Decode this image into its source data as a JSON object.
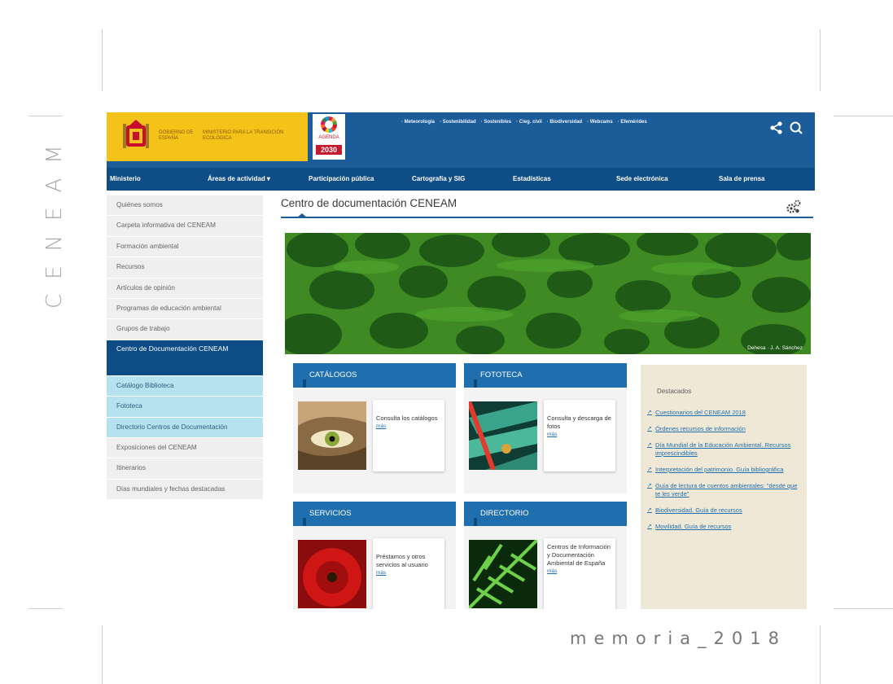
{
  "doc": {
    "side_title": "CENEAM",
    "footer": "memoria_2018"
  },
  "header": {
    "gov_label_1": "GOBIERNO DE ESPAÑA",
    "gov_label_2": "MINISTERIO PARA LA TRANSICIÓN ECOLÓGICA",
    "agenda_label": "AGENDA",
    "agenda_year": "2030",
    "top_links": [
      "Meteorología",
      "Sostenibilidad",
      "Sostenibles",
      "Cieg. civil",
      "Biodiversidad",
      "Webcams",
      "Efemérides"
    ]
  },
  "nav": [
    "Ministerio",
    "Áreas de actividad ▾",
    "Participación pública",
    "Cartografía y SIG",
    "Estadísticas",
    "Sede electrónica",
    "Sala de prensa"
  ],
  "sidebar": [
    {
      "label": "Quiénes somos",
      "state": "normal"
    },
    {
      "label": "Carpeta informativa del CENEAM",
      "state": "normal"
    },
    {
      "label": "Formación ambiental",
      "state": "normal"
    },
    {
      "label": "Recursos",
      "state": "normal"
    },
    {
      "label": "Artículos de opinión",
      "state": "normal"
    },
    {
      "label": "Programas de educación ambiental",
      "state": "normal"
    },
    {
      "label": "Grupos de trabajo",
      "state": "normal"
    },
    {
      "label": "Centro de Documentación CENEAM",
      "state": "active"
    },
    {
      "label": "Catálogo Biblioteca",
      "state": "sub"
    },
    {
      "label": "Fototeca",
      "state": "sub"
    },
    {
      "label": "Directorio Centros de Documentación",
      "state": "sub"
    },
    {
      "label": "Exposiciones del CENEAM",
      "state": "normal"
    },
    {
      "label": "Itinerarios",
      "state": "normal"
    },
    {
      "label": "Días mundiales y fechas destacadas",
      "state": "normal"
    }
  ],
  "main": {
    "title": "Centro de documentación CENEAM",
    "hero_credit": "Dehesa · J. A. Sánchez",
    "panels": [
      {
        "heading": "CATÁLOGOS",
        "text": "Consulta los catálogos",
        "more": "más"
      },
      {
        "heading": "FOTOTECA",
        "text": "Consulta y descarga de fotos",
        "more": "más"
      },
      {
        "heading": "SERVICIOS",
        "text": "Préstamos y otros servicios al usuario",
        "more": "más"
      },
      {
        "heading": "DIRECTORIO",
        "text": "Centros de Información y Documentación Ambiental de España",
        "more": "más"
      }
    ]
  },
  "featured": {
    "title": "Destacados",
    "items": [
      "Cuestionarios del CENEAM 2018",
      "Órdenes recursos de información",
      "Día Mundial de la Educación Ambiental. Recursos imprescindibles",
      "Interpretación del patrimonio. Guía bibliográfica",
      "Guía de lectura de cuentos ambientales: \"desde que te les verde\"",
      "Biodiversidad. Guía de recursos",
      "Movilidad. Guía de recursos"
    ]
  },
  "colors": {
    "gov_yellow": "#f3c31a",
    "header_blue": "#1c5c99",
    "nav_blue": "#0f4d86",
    "panel_blue": "#1f6fae",
    "sub_light": "#b6e1ee",
    "feature_bg": "#efe8d6"
  }
}
